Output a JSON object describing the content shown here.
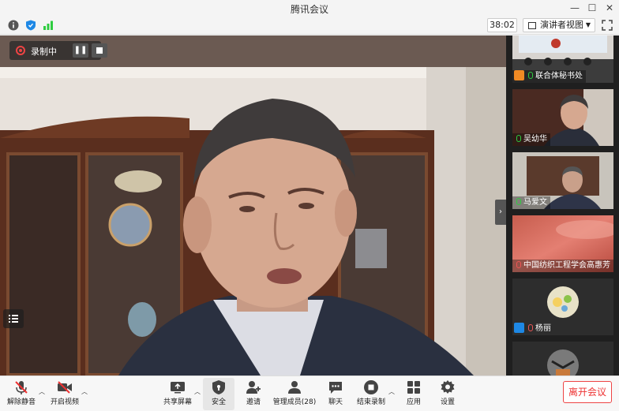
{
  "window": {
    "title": "腾讯会议",
    "minimize": "—",
    "maximize": "☐",
    "close": "✕"
  },
  "infobar": {
    "timer": "38:02",
    "view_mode": "演讲者视图"
  },
  "recording": {
    "label": "录制中"
  },
  "participants": [
    {
      "name": "联合体秘书处",
      "role": "host",
      "mic": "on"
    },
    {
      "name": "吴幼华",
      "role": "",
      "mic": "on"
    },
    {
      "name": "马爱文",
      "role": "",
      "mic": "on"
    },
    {
      "name": "中国纺织工程学会高惠芳",
      "role": "",
      "mic": "muted"
    },
    {
      "name": "杨丽",
      "role": "cohost",
      "mic": "muted"
    },
    {
      "name": "",
      "role": "",
      "mic": ""
    }
  ],
  "toolbar": {
    "unmute": "解除静音",
    "start_video": "开启视频",
    "share_screen": "共享屏幕",
    "security": "安全",
    "invite": "邀请",
    "manage_members": "管理成员(28)",
    "chat": "聊天",
    "end_recording": "结束录制",
    "apps": "应用",
    "settings": "设置",
    "leave": "离开会议"
  },
  "colors": {
    "accent": "#1e88e5",
    "danger": "#e33333",
    "host": "#f08a24",
    "mic_on": "#2ecc40"
  }
}
